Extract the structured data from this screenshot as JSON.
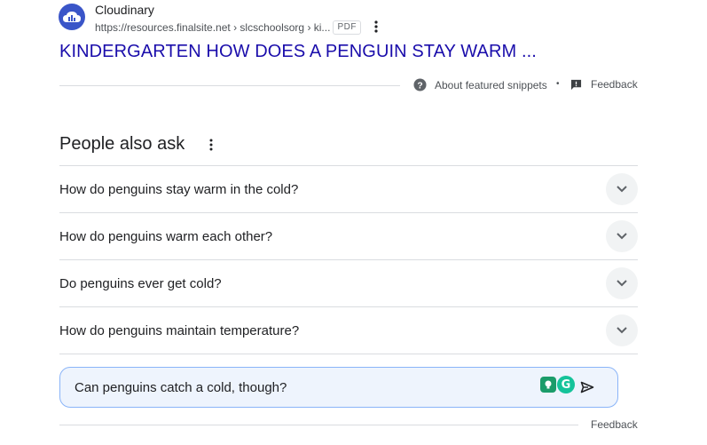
{
  "result": {
    "site_name": "Cloudinary",
    "url": "https://resources.finalsite.net › slcschoolsorg › ki...",
    "badge": "PDF",
    "title": "KINDERGARTEN HOW DOES A PENGUIN STAY WARM ...",
    "logo_icon": "cloudinary-logo",
    "menu_icon": "more-vert-icon"
  },
  "snippet_footer": {
    "about_label": "About featured snippets",
    "separator": "•",
    "feedback_label": "Feedback"
  },
  "paa": {
    "title": "People also ask",
    "questions": [
      "How do penguins stay warm in the cold?",
      "How do penguins warm each other?",
      "Do penguins ever get cold?",
      "How do penguins maintain temperature?"
    ]
  },
  "ask": {
    "text": "Can penguins catch a cold, though?",
    "extension_letter": "G"
  },
  "footer": {
    "feedback_label": "Feedback"
  },
  "colors": {
    "link": "#1a0dab",
    "accent_border": "#8ab4f8",
    "ask_bg": "#eef4fd",
    "logo_bg": "#3a55c8"
  }
}
